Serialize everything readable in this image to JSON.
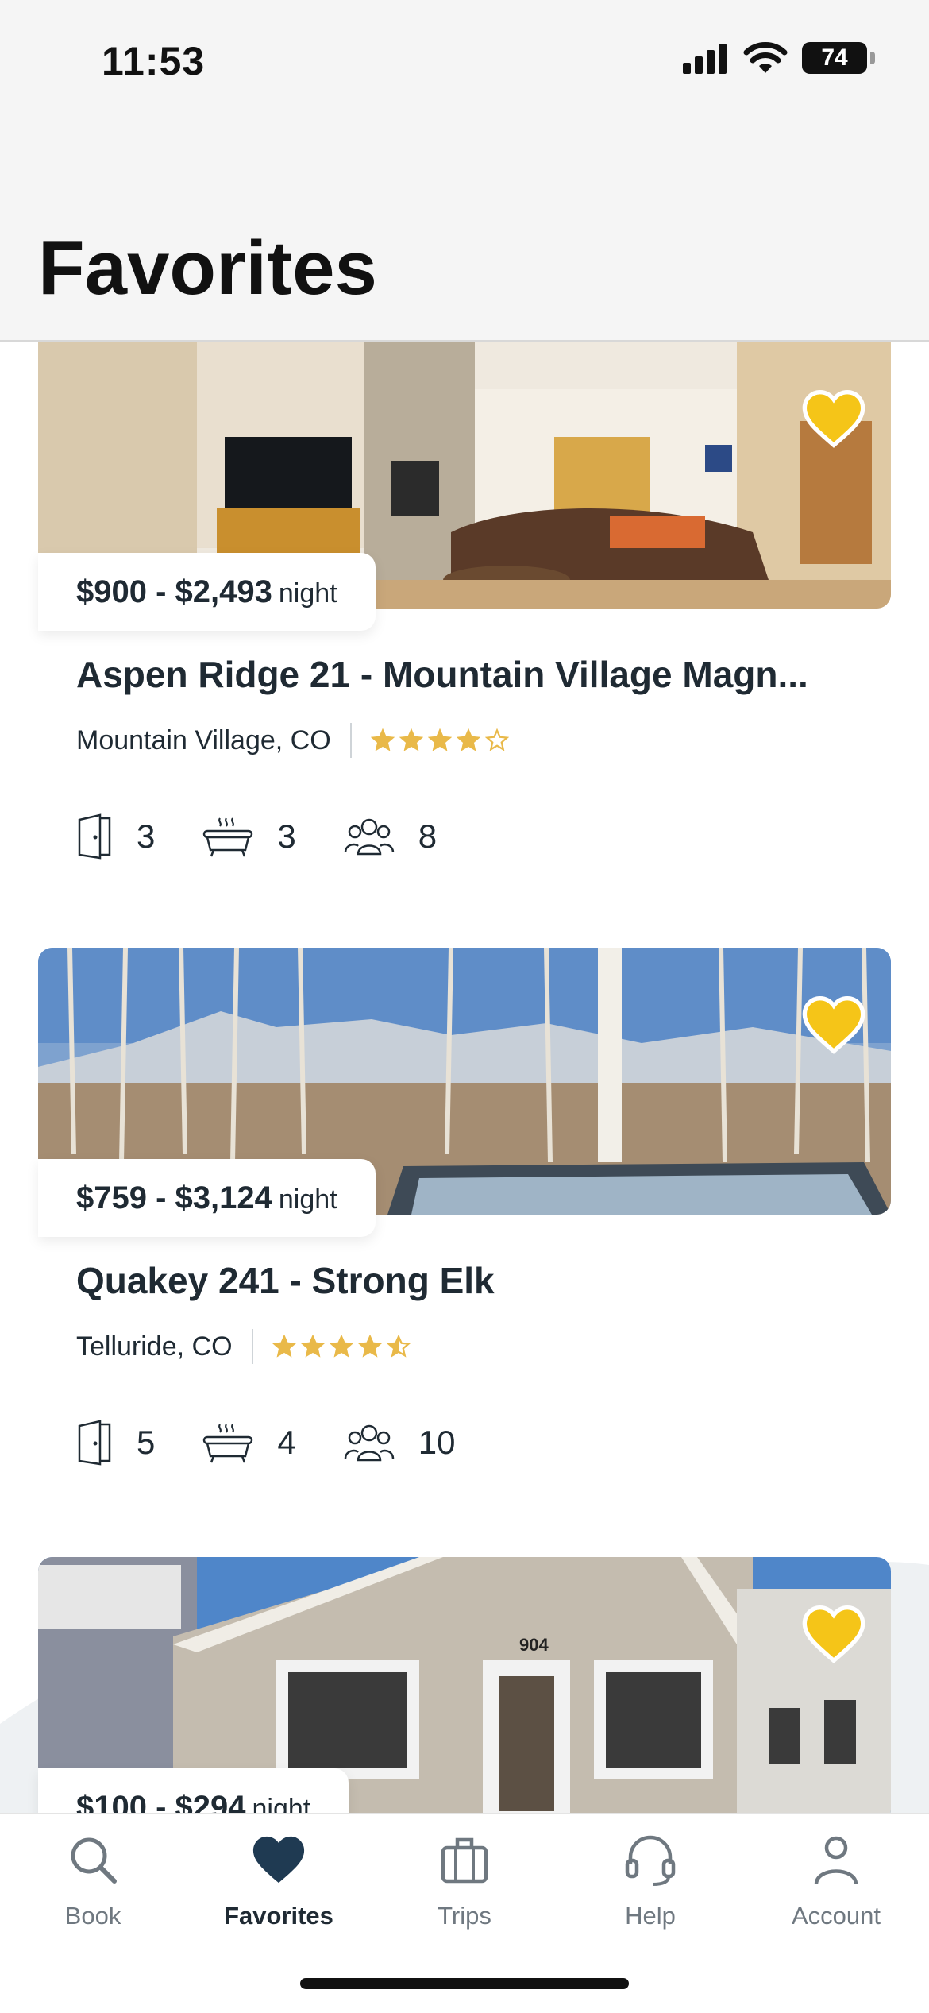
{
  "status_bar": {
    "time": "11:53",
    "battery": "74"
  },
  "header": {
    "title": "Favorites"
  },
  "listings": [
    {
      "price_range": "$900 - $2,493",
      "price_unit": "night",
      "title": "Aspen Ridge 21 - Mountain Village Magn...",
      "location": "Mountain Village, CO",
      "rating": 4.0,
      "bedrooms": "3",
      "bathrooms": "3",
      "guests": "8"
    },
    {
      "price_range": "$759 - $3,124",
      "price_unit": "night",
      "title": "Quakey 241 - Strong Elk",
      "location": "Telluride, CO",
      "rating": 4.5,
      "bedrooms": "5",
      "bathrooms": "4",
      "guests": "10"
    },
    {
      "price_range": "$100 - $294",
      "price_unit": "night",
      "house_number": "904"
    }
  ],
  "tabs": [
    {
      "label": "Book",
      "icon": "search-icon",
      "active": false
    },
    {
      "label": "Favorites",
      "icon": "heart-icon",
      "active": true
    },
    {
      "label": "Trips",
      "icon": "suitcase-icon",
      "active": false
    },
    {
      "label": "Help",
      "icon": "headset-icon",
      "active": false
    },
    {
      "label": "Account",
      "icon": "user-icon",
      "active": false
    }
  ],
  "colors": {
    "accent_gold": "#f5c518",
    "star_gold": "#e9b949",
    "text_dark": "#1f2a33",
    "tab_inactive": "#6f7880"
  }
}
